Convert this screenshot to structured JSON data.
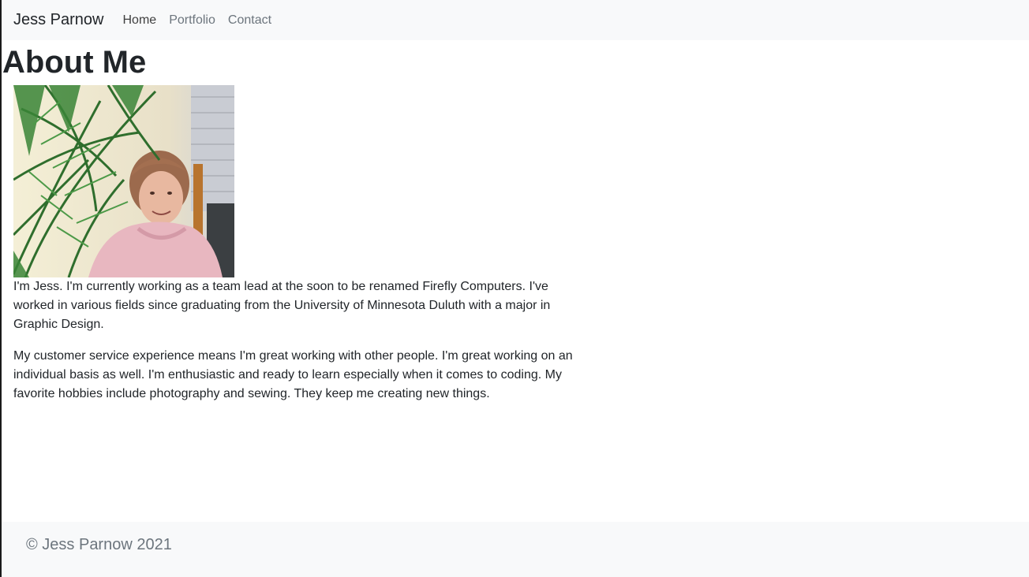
{
  "navbar": {
    "brand": "Jess Parnow",
    "links": [
      "Home",
      "Portfolio",
      "Contact"
    ]
  },
  "main": {
    "title": "About Me",
    "photo_alt": "Photo of Jess Parnow",
    "paragraphs": [
      "I'm Jess. I'm currently working as a team lead at the soon to be renamed Firefly Computers. I've worked in various fields since graduating from the University of Minnesota Duluth with a major in Graphic Design.",
      "My customer service experience means I'm great working with other people. I'm great working on an individual basis as well. I'm enthusiastic and ready to learn especially when it comes to coding. My favorite hobbies include photography and sewing. They keep me creating new things."
    ]
  },
  "footer": {
    "text": "© Jess Parnow 2021"
  }
}
